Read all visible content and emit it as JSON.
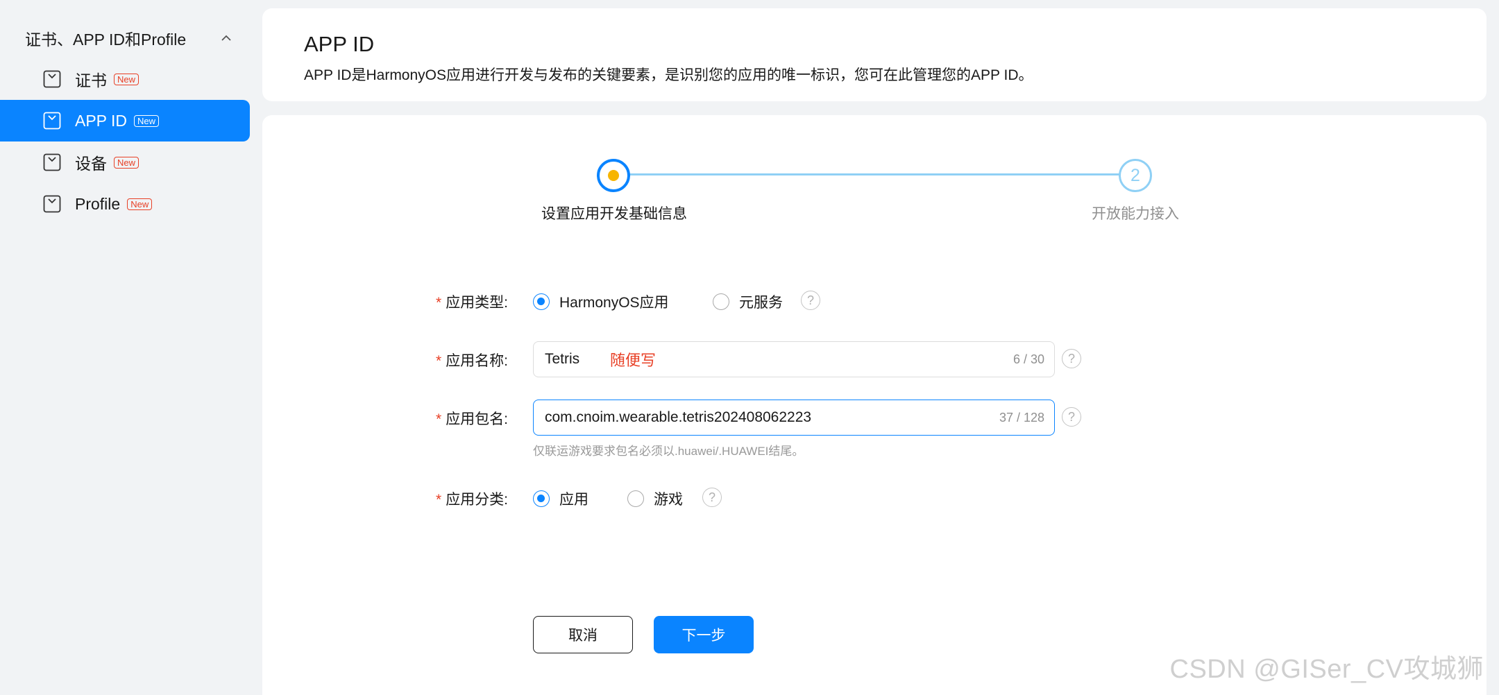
{
  "sidebar": {
    "group_label": "证书、APP ID和Profile",
    "items": [
      {
        "label": "证书",
        "badge": "New"
      },
      {
        "label": "APP ID",
        "badge": "New"
      },
      {
        "label": "设备",
        "badge": "New"
      },
      {
        "label": "Profile",
        "badge": "New"
      }
    ]
  },
  "header": {
    "title": "APP ID",
    "description": "APP ID是HarmonyOS应用进行开发与发布的关键要素，是识别您的应用的唯一标识，您可在此管理您的APP ID。"
  },
  "stepper": {
    "steps": [
      {
        "number": "",
        "label": "设置应用开发基础信息"
      },
      {
        "number": "2",
        "label": "开放能力接入"
      }
    ]
  },
  "form": {
    "required_mark": "*",
    "app_type": {
      "label": "应用类型:",
      "options": [
        "HarmonyOS应用",
        "元服务"
      ],
      "selected": "HarmonyOS应用"
    },
    "app_name": {
      "label": "应用名称:",
      "value": "Tetris",
      "count": "6 / 30",
      "annotation": "随便写"
    },
    "package_name": {
      "label": "应用包名:",
      "value": "com.cnoim.wearable.tetris202408062223",
      "count": "37 / 128",
      "hint": "仅联运游戏要求包名必须以.huawei/.HUAWEI结尾。"
    },
    "category": {
      "label": "应用分类:",
      "options": [
        "应用",
        "游戏"
      ],
      "selected": "应用"
    },
    "help_glyph": "?"
  },
  "buttons": {
    "cancel": "取消",
    "next": "下一步"
  },
  "watermark": "CSDN @GISer_CV攻城狮",
  "colors": {
    "accent": "#0a84ff",
    "required": "#e84026",
    "step_pending": "#8fd0f5",
    "step_dot": "#f7b500"
  }
}
